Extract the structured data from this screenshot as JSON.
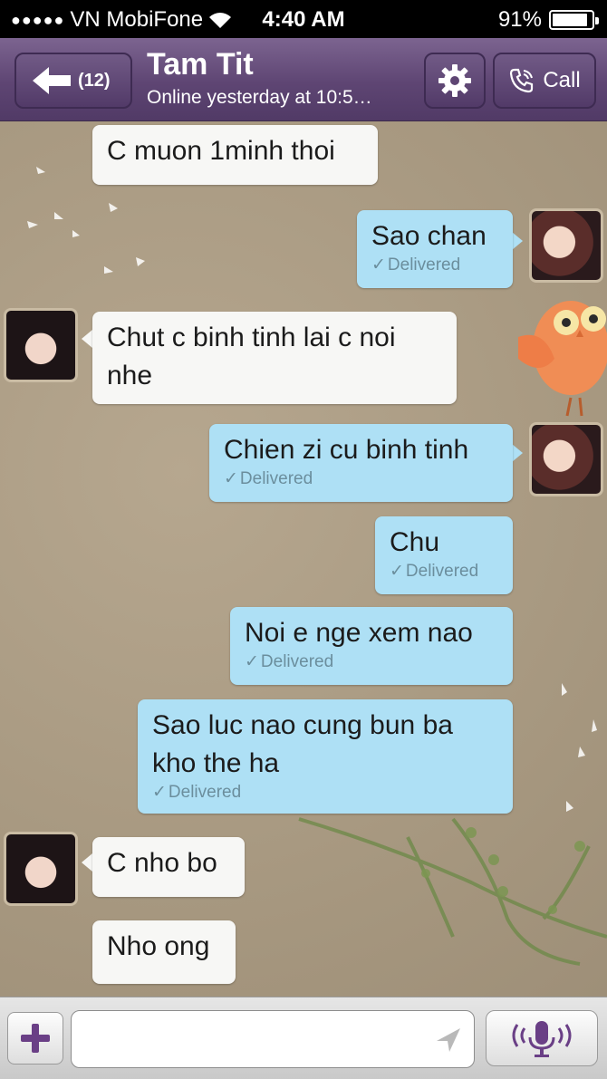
{
  "status_bar": {
    "carrier": "VN MobiFone",
    "time": "4:40 AM",
    "battery": "91%",
    "battery_level": 0.91
  },
  "nav": {
    "back_count": "(12)",
    "contact_name": "Tam Tit",
    "contact_status": "Online yesterday at 10:5…",
    "call_label": "Call"
  },
  "messages": [
    {
      "dir": "in",
      "text": "C muon 1minh thoi"
    },
    {
      "dir": "out",
      "text": "Sao chan",
      "status": "Delivered"
    },
    {
      "dir": "in",
      "text": "Chut c binh tinh lai c noi nhe"
    },
    {
      "dir": "out",
      "text": "Chien zi cu binh tinh",
      "status": "Delivered"
    },
    {
      "dir": "out",
      "text": "Chu",
      "status": "Delivered"
    },
    {
      "dir": "out",
      "text": "Noi e nge xem nao",
      "status": "Delivered"
    },
    {
      "dir": "out",
      "text": "Sao luc nao cung bun ba kho the ha",
      "status": "Delivered"
    },
    {
      "dir": "in",
      "text": "C nho bo"
    },
    {
      "dir": "in",
      "text": "Nho ong"
    }
  ],
  "input": {
    "value": "",
    "placeholder": ""
  },
  "colors": {
    "nav_purple": "#5e4573",
    "outgoing_bubble": "#aee0f5",
    "incoming_bubble": "#f7f7f5",
    "accent": "#6a3f86"
  }
}
